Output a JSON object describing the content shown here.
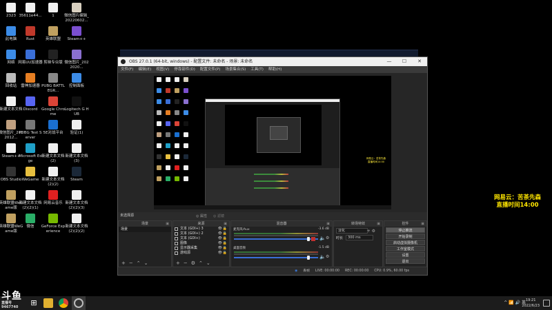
{
  "desktop": {
    "icons": [
      {
        "label": "2323",
        "color": "#f0f0f0"
      },
      {
        "label": "35611e44...",
        "color": "#f0f0f0"
      },
      {
        "label": "1",
        "color": "#f0f0f0"
      },
      {
        "label": "微信图片编辑_20220602...",
        "color": "#d8d0c0"
      },
      {
        "label": "此电脑",
        "color": "#3c8ce7"
      },
      {
        "label": "Rust",
        "color": "#c0392b"
      },
      {
        "label": "英雄联盟",
        "color": "#c0a060"
      },
      {
        "label": "Steam++",
        "color": "#7b4fd0"
      },
      {
        "label": "网络",
        "color": "#3c8ce7"
      },
      {
        "label": "网易UU加速器",
        "color": "#3a6fd8"
      },
      {
        "label": "剪映专业版",
        "color": "#222"
      },
      {
        "label": "微信图片_2022020...",
        "color": "#8a6fd0"
      },
      {
        "label": "回收站",
        "color": "#bbb"
      },
      {
        "label": "雷神加速器",
        "color": "#e67e22"
      },
      {
        "label": "PUBG BATTLEGR...",
        "color": "#888"
      },
      {
        "label": "控制面板",
        "color": "#3c8ce7"
      },
      {
        "label": "新建文本文档",
        "color": "#f0f0f0"
      },
      {
        "label": "Discord",
        "color": "#5865f2"
      },
      {
        "label": "Google Chrome",
        "color": "#db4437"
      },
      {
        "label": "Logitech G HUB",
        "color": "#111"
      },
      {
        "label": "微信图片_2022012...",
        "color": "#c0a080"
      },
      {
        "label": "PUBG Test Server",
        "color": "#777"
      },
      {
        "label": "5E对战平台",
        "color": "#1a6fd0"
      },
      {
        "label": "验证(1)",
        "color": "#f0f0f0"
      },
      {
        "label": "Steam++",
        "color": "#f0f0f0"
      },
      {
        "label": "Microsoft Edge",
        "color": "#1fa0c8"
      },
      {
        "label": "新建文本文档(2)",
        "color": "#f0f0f0"
      },
      {
        "label": "新建文本文档(3)",
        "color": "#f0f0f0"
      },
      {
        "label": "OBS Studio",
        "color": "#333"
      },
      {
        "label": "WeGame",
        "color": "#e8c040"
      },
      {
        "label": "新建文本文档(2)(2)",
        "color": "#f0f0f0"
      },
      {
        "label": "Steam",
        "color": "#1b2838"
      },
      {
        "label": "英雄联盟WeGame版",
        "color": "#c0a060"
      },
      {
        "label": "新建文本文档(2)(2)(1)",
        "color": "#f0f0f0"
      },
      {
        "label": "网易云音乐",
        "color": "#e02020"
      },
      {
        "label": "新建文本文档(2)(2)(3)",
        "color": "#f0f0f0"
      },
      {
        "label": "英雄联盟WeGame版",
        "color": "#c0a060"
      },
      {
        "label": "微信",
        "color": "#2aae67"
      },
      {
        "label": "GeForce Experience",
        "color": "#76b900"
      },
      {
        "label": "新建文本文档(2)(2)(2)",
        "color": "#f0f0f0"
      }
    ]
  },
  "obs": {
    "title": "OBS 27.0.1 (64-bit, windows) - 配置文件: 未命名 - 场景: 未命名",
    "menu": [
      "文件(F)",
      "编辑(E)",
      "视图(V)",
      "停靠部件(D)",
      "配置文件(P)",
      "场景集合(S)",
      "工具(T)",
      "帮助(H)"
    ],
    "scene_label": "未选择源",
    "props_btn": "◎ 属性",
    "filters_btn": "◎ 滤镜",
    "mini_overlay": [
      "网易云：苦茶先森",
      "直播时间14:00"
    ],
    "docks": {
      "scenes": {
        "title": "场景",
        "items": [
          "场景"
        ]
      },
      "sources": {
        "title": "来源",
        "items": [
          {
            "label": "文本 (GDI+) 3",
            "icon": "text-icon"
          },
          {
            "label": "文本 (GDI+) 2",
            "icon": "text-icon"
          },
          {
            "label": "文本 (GDI+)",
            "icon": "text-icon"
          },
          {
            "label": "图像",
            "icon": "image-icon"
          },
          {
            "label": "显示器采集",
            "icon": "monitor-icon"
          },
          {
            "label": "游戏源",
            "icon": "gamepad-icon"
          }
        ]
      },
      "mixer": {
        "title": "混音器",
        "channels": [
          {
            "name": "麦克风/Aux",
            "db": "-3.6 dB"
          },
          {
            "name": "桌面音频",
            "db": "-1.5 dB"
          }
        ]
      },
      "transitions": {
        "title": "转场特效",
        "selected": "淡化",
        "duration_label": "时长",
        "duration": "300 ms"
      },
      "controls": {
        "title": "控件",
        "buttons": [
          "停止推流",
          "开始录制",
          "启动虚拟摄像机",
          "工作室模式",
          "设置",
          "退出"
        ]
      }
    },
    "status": {
      "live": "LIVE: 00:00:00",
      "rec": "REC: 00:00:00",
      "cpu": "CPU: 0.9%, 60.00 fps",
      "dropped": "丢帧"
    }
  },
  "overlay": {
    "line1": "网易云：苦茶先森",
    "line2": "直播时间14:00"
  },
  "taskbar": {
    "start": "⊞",
    "tray": "^ 📶 🔊 英",
    "time": "19:21",
    "date": "2022/6/23"
  },
  "watermark": {
    "brand": "斗鱼",
    "sub": "直播号",
    "id": "9467740"
  }
}
